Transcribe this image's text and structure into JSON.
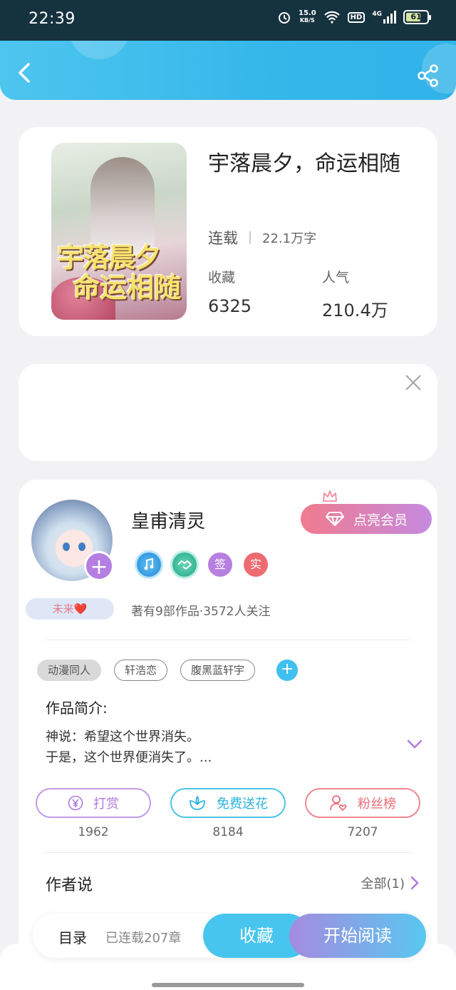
{
  "status_bar": {
    "time": "22:39",
    "speed_value": "15.0",
    "speed_unit": "KB/S",
    "hd_label": "HD",
    "network_label": "4G",
    "battery": "61"
  },
  "header": {
    "back_icon": "chevron-left-icon",
    "share_icon": "share-icon"
  },
  "book": {
    "cover_title_line1": "宇落晨夕",
    "cover_title_line2": "命运相随",
    "title": "宇落晨夕，命运相随",
    "status": "连载",
    "word_count": "22.1万字",
    "collect_label": "收藏",
    "collect_value": "6325",
    "popularity_label": "人气",
    "popularity_value": "210.4万"
  },
  "ad": {
    "close_icon": "close-icon"
  },
  "author": {
    "name": "皇甫清灵",
    "mood": "未来❤️",
    "vip_button": "点亮会员",
    "badges": [
      "",
      "",
      "签",
      "实"
    ],
    "works_info": "著有9部作品·3572人关注"
  },
  "tags": [
    "动漫同人",
    "轩浩恋",
    "腹黑蓝轩宇"
  ],
  "intro": {
    "title": "作品简介:",
    "line1": "神说：希望这个世界消失。",
    "line2": "于是，这个世界便消失了。..."
  },
  "actions": [
    {
      "label": "打赏",
      "count": "1962",
      "icon": "yen-icon"
    },
    {
      "label": "免费送花",
      "count": "8184",
      "icon": "flower-icon"
    },
    {
      "label": "粉丝榜",
      "count": "7207",
      "icon": "user-heart-icon"
    }
  ],
  "author_say": {
    "title": "作者说",
    "all_link": "全部(1)"
  },
  "bottom_bar": {
    "toc": "目录",
    "chapters": "已连载207章",
    "collect": "收藏",
    "read": "开始阅读"
  },
  "colors": {
    "accent_blue": "#47c5ef",
    "accent_purple": "#b57ee2",
    "accent_pink": "#f07b8e"
  }
}
